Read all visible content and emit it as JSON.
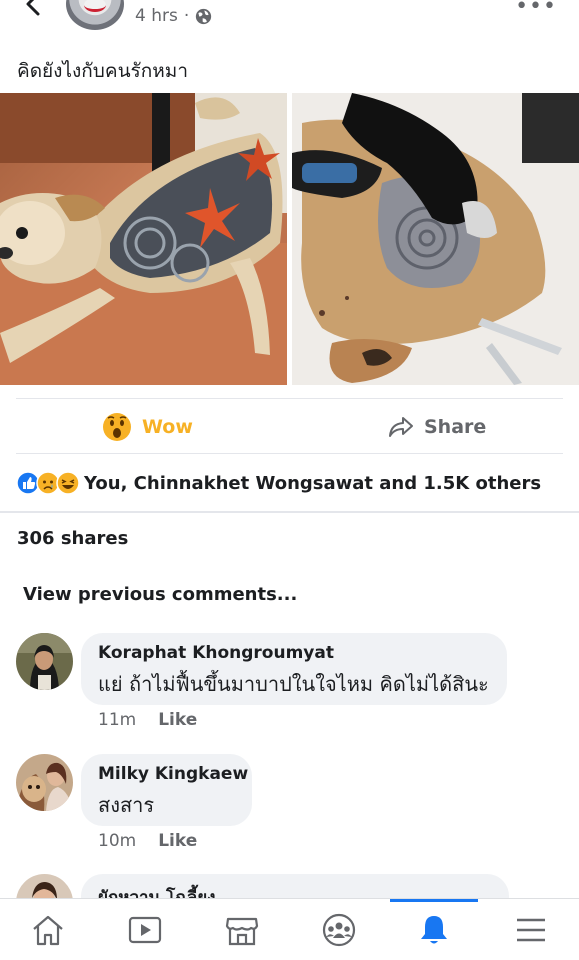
{
  "header": {
    "time": "4 hrs",
    "separator": "·",
    "icons": {
      "back": "back-arrow-icon",
      "privacy": "globe-icon",
      "more": "more-options-icon"
    }
  },
  "post": {
    "caption": "คิดยังไงกับคนรักหมา",
    "actions": {
      "wow_label": "Wow",
      "share_label": "Share"
    },
    "reactions_text": "You, Chinnakhet Wongsawat and 1.5K others",
    "reaction_icons": [
      "like-reaction-icon",
      "sad-reaction-icon",
      "haha-reaction-icon"
    ],
    "shares_text": "306 shares"
  },
  "comments_section": {
    "view_previous": "View previous comments...",
    "comments": [
      {
        "name": "Koraphat Khongroumyat",
        "text": "แย่ ถ้าไม่ฟื้นขึ้นมาบาปในใจไหม คิดไม่ได้สินะ",
        "time": "11m",
        "like_label": "Like"
      },
      {
        "name": "Milky Kingkaew",
        "text": "สงสาร",
        "time": "10m",
        "like_label": "Like"
      },
      {
        "name": "ผักหวาน โฉลี้ยง"
      }
    ]
  },
  "tabbar": {
    "tabs": [
      "home-icon",
      "watch-icon",
      "marketplace-icon",
      "groups-icon",
      "notifications-icon",
      "menu-icon"
    ],
    "active": "notifications-icon"
  },
  "colors": {
    "wow": "#f7b125",
    "accent": "#1877f2",
    "secondary_text": "#65676b",
    "bubble": "#f0f2f5"
  }
}
